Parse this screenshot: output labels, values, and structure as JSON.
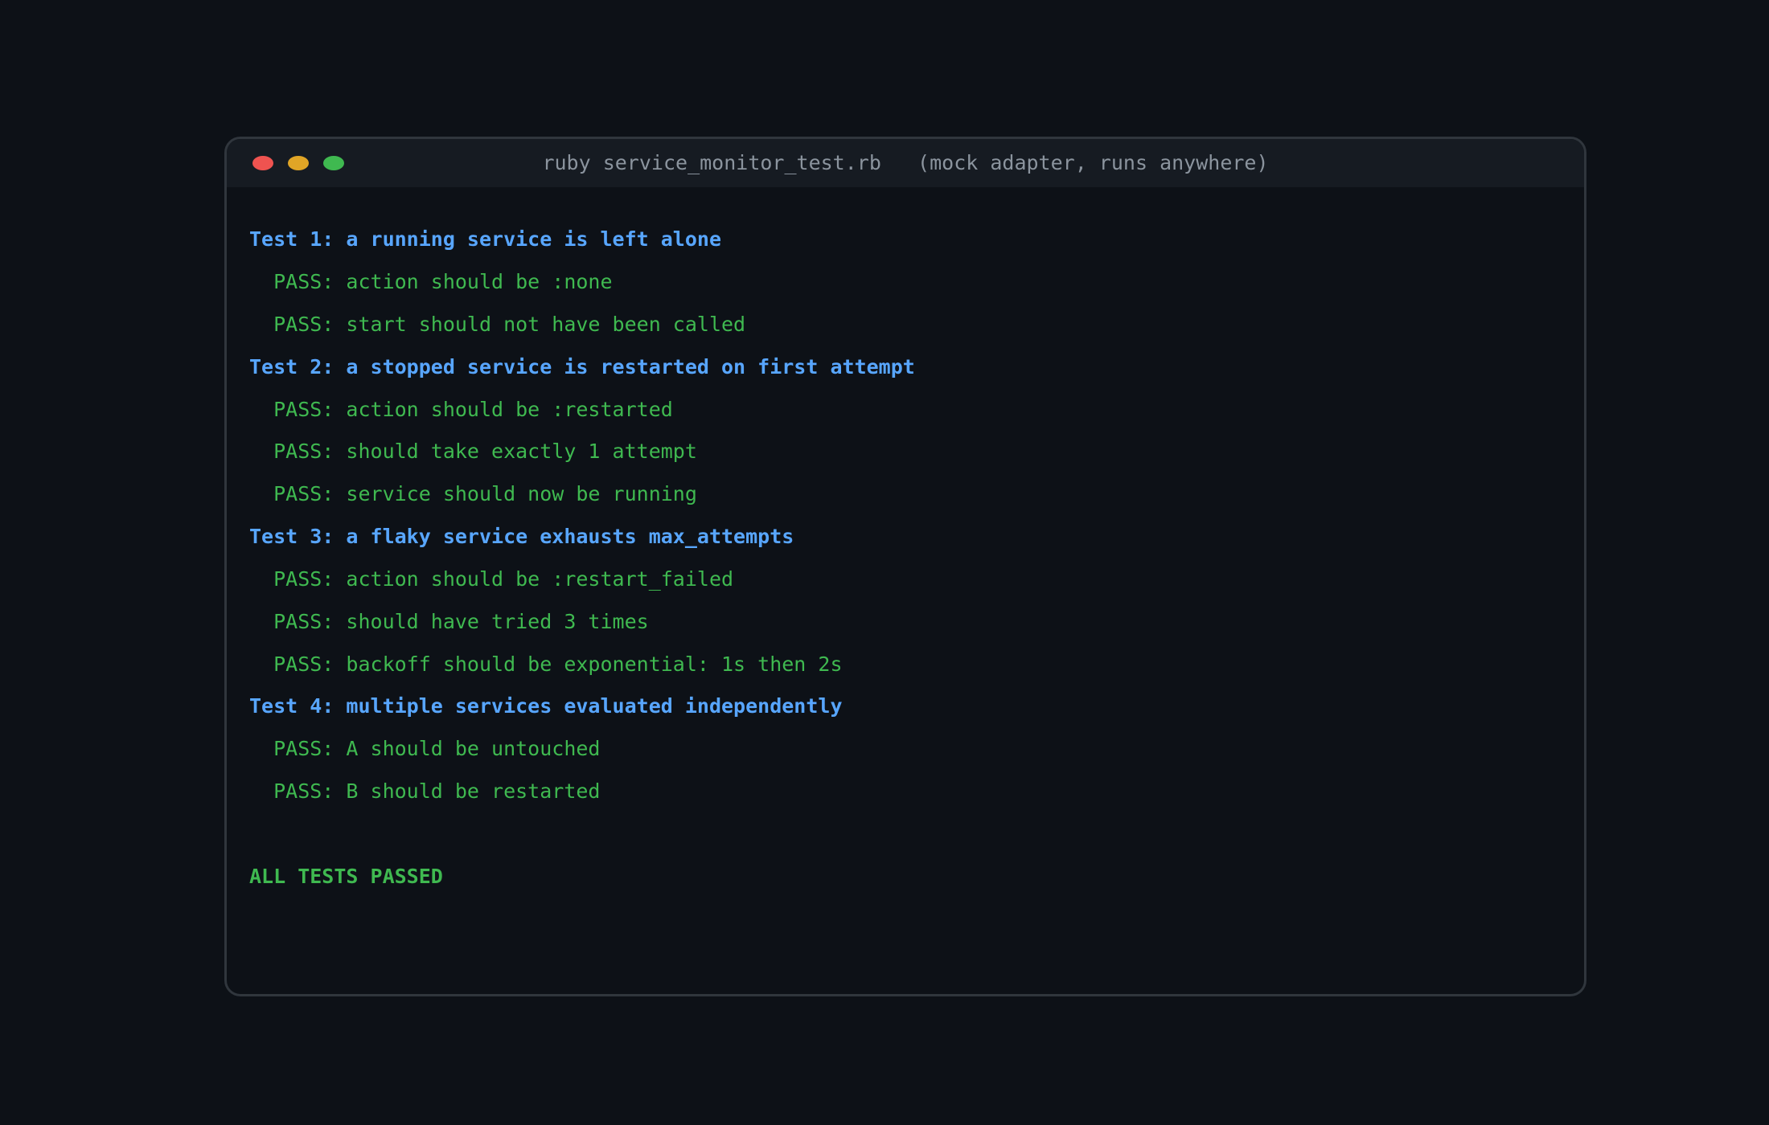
{
  "window": {
    "title": "ruby service_monitor_test.rb   (mock adapter, runs anywhere)",
    "traffic_lights": [
      {
        "name": "close",
        "color": "#ef5350"
      },
      {
        "name": "minimize",
        "color": "#e0a526"
      },
      {
        "name": "maximize",
        "color": "#3fb950"
      }
    ]
  },
  "colors": {
    "background": "#0d1117",
    "test_header": "#58a6ff",
    "pass": "#3fb950",
    "title_text": "#8b949e"
  },
  "output": {
    "tests": [
      {
        "header": "Test 1: a running service is left alone",
        "results": [
          "  PASS: action should be :none",
          "  PASS: start should not have been called"
        ]
      },
      {
        "header": "Test 2: a stopped service is restarted on first attempt",
        "results": [
          "  PASS: action should be :restarted",
          "  PASS: should take exactly 1 attempt",
          "  PASS: service should now be running"
        ]
      },
      {
        "header": "Test 3: a flaky service exhausts max_attempts",
        "results": [
          "  PASS: action should be :restart_failed",
          "  PASS: should have tried 3 times",
          "  PASS: backoff should be exponential: 1s then 2s"
        ]
      },
      {
        "header": "Test 4: multiple services evaluated independently",
        "results": [
          "  PASS: A should be untouched",
          "  PASS: B should be restarted"
        ]
      }
    ],
    "summary": "ALL TESTS PASSED"
  }
}
